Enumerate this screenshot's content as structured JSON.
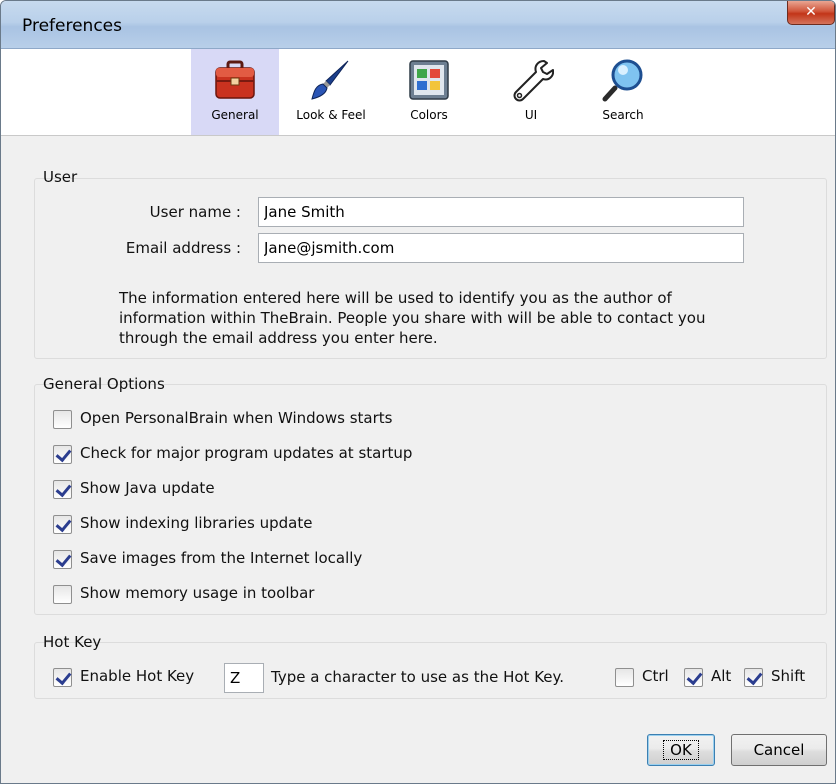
{
  "window": {
    "title": "Preferences",
    "close_glyph": "✕"
  },
  "toolbar": {
    "items": [
      {
        "label": "General",
        "icon": "toolbox-icon",
        "selected": true
      },
      {
        "label": "Look & Feel",
        "icon": "paintbrush-icon",
        "selected": false
      },
      {
        "label": "Colors",
        "icon": "color-palette-icon",
        "selected": false
      },
      {
        "label": "UI",
        "icon": "wrench-icon",
        "selected": false
      },
      {
        "label": "Search",
        "icon": "magnifier-icon",
        "selected": false
      }
    ]
  },
  "user_group": {
    "title": "User",
    "username_label": "User name :",
    "username_value": "Jane Smith",
    "email_label": "Email address :",
    "email_value": "Jane@jsmith.com",
    "info_lines": [
      "The information entered here will be used to identify you as the author of",
      "information within TheBrain. People you share with will be able to contact you",
      "through the email address you enter here."
    ]
  },
  "general_options": {
    "title": "General Options",
    "items": [
      {
        "label": "Open PersonalBrain when Windows starts",
        "checked": false
      },
      {
        "label": "Check for major program updates at startup",
        "checked": true
      },
      {
        "label": "Show Java update",
        "checked": true
      },
      {
        "label": "Show indexing libraries update",
        "checked": true
      },
      {
        "label": "Save images from the Internet locally",
        "checked": true
      },
      {
        "label": "Show memory usage in toolbar",
        "checked": false
      }
    ]
  },
  "hot_key": {
    "title": "Hot Key",
    "enable_label": "Enable Hot Key",
    "enable_checked": true,
    "key_value": "Z",
    "hint": "Type a character to use as the Hot Key.",
    "ctrl_label": "Ctrl",
    "ctrl_checked": false,
    "alt_label": "Alt",
    "alt_checked": true,
    "shift_label": "Shift",
    "shift_checked": true
  },
  "buttons": {
    "ok": "OK",
    "cancel": "Cancel"
  },
  "colors": {
    "selected_tab": "#d8d9f6",
    "check_mark": "#2b3d8f",
    "title_bar": "#b9d0ea"
  }
}
